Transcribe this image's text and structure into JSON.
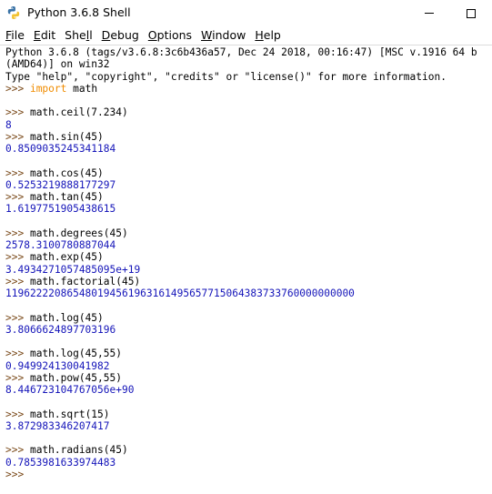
{
  "window": {
    "title": "Python 3.6.8 Shell"
  },
  "menu": [
    {
      "mnemonic": "F",
      "rest": "ile"
    },
    {
      "mnemonic": "E",
      "rest": "dit"
    },
    {
      "pre": "She",
      "mnemonic": "l",
      "rest": "l"
    },
    {
      "mnemonic": "D",
      "rest": "ebug"
    },
    {
      "mnemonic": "O",
      "rest": "ptions"
    },
    {
      "mnemonic": "W",
      "rest": "indow"
    },
    {
      "mnemonic": "H",
      "rest": "elp"
    }
  ],
  "colors": {
    "output": "#1515b9",
    "prompt": "#7a4a1a",
    "keyword": "#f08c00"
  },
  "shell": {
    "lines": [
      {
        "type": "banner",
        "text": "Python 3.6.8 (tags/v3.6.8:3c6b436a57, Dec 24 2018, 00:16:47) [MSC v.1916 64 b"
      },
      {
        "type": "banner",
        "text": "(AMD64)] on win32"
      },
      {
        "type": "banner",
        "text": "Type \"help\", \"copyright\", \"credits\" or \"license()\" for more information."
      },
      {
        "type": "input",
        "prompt": ">>> ",
        "keyword": "import",
        "code": " math"
      },
      {
        "type": "blank",
        "text": ""
      },
      {
        "type": "input",
        "prompt": ">>> ",
        "code": "math.ceil(7.234)"
      },
      {
        "type": "output",
        "text": "8"
      },
      {
        "type": "input",
        "prompt": ">>> ",
        "code": "math.sin(45)"
      },
      {
        "type": "output",
        "text": "0.8509035245341184"
      },
      {
        "type": "blank",
        "text": ""
      },
      {
        "type": "input",
        "prompt": ">>> ",
        "code": "math.cos(45)"
      },
      {
        "type": "output",
        "text": "0.5253219888177297"
      },
      {
        "type": "input",
        "prompt": ">>> ",
        "code": "math.tan(45)"
      },
      {
        "type": "output",
        "text": "1.6197751905438615"
      },
      {
        "type": "blank",
        "text": ""
      },
      {
        "type": "input",
        "prompt": ">>> ",
        "code": "math.degrees(45)"
      },
      {
        "type": "output",
        "text": "2578.3100780887044"
      },
      {
        "type": "input",
        "prompt": ">>> ",
        "code": "math.exp(45)"
      },
      {
        "type": "output",
        "text": "3.4934271057485095e+19"
      },
      {
        "type": "input",
        "prompt": ">>> ",
        "code": "math.factorial(45)"
      },
      {
        "type": "output",
        "text": "119622220865480194561963161495657715064383733760000000000"
      },
      {
        "type": "blank",
        "text": ""
      },
      {
        "type": "input",
        "prompt": ">>> ",
        "code": "math.log(45)"
      },
      {
        "type": "output",
        "text": "3.8066624897703196"
      },
      {
        "type": "blank",
        "text": ""
      },
      {
        "type": "input",
        "prompt": ">>> ",
        "code": "math.log(45,55)"
      },
      {
        "type": "output",
        "text": "0.949924130041982"
      },
      {
        "type": "input",
        "prompt": ">>> ",
        "code": "math.pow(45,55)"
      },
      {
        "type": "output",
        "text": "8.446723104767056e+90"
      },
      {
        "type": "blank",
        "text": ""
      },
      {
        "type": "input",
        "prompt": ">>> ",
        "code": "math.sqrt(15)"
      },
      {
        "type": "output",
        "text": "3.872983346207417"
      },
      {
        "type": "blank",
        "text": ""
      },
      {
        "type": "input",
        "prompt": ">>> ",
        "code": "math.radians(45)"
      },
      {
        "type": "output",
        "text": "0.7853981633974483"
      },
      {
        "type": "input",
        "prompt": ">>> ",
        "code": ""
      }
    ]
  }
}
